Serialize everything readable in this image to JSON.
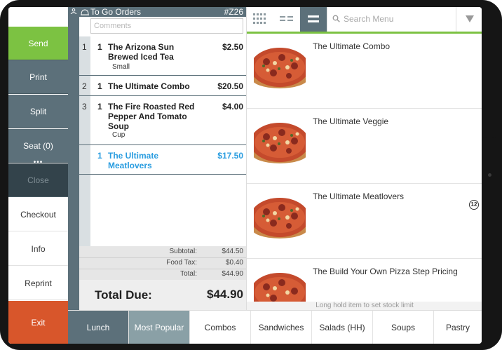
{
  "left_buttons": {
    "send": "Send",
    "print": "Print",
    "split": "Split",
    "seat": "Seat (0)",
    "seat_more": "•••",
    "close": "Close",
    "checkout": "Checkout",
    "info": "Info",
    "reprint": "Reprint",
    "exit": "Exit"
  },
  "order": {
    "title": "To Go Orders",
    "number": "#Z26",
    "comments_placeholder": "Comments",
    "lines": [
      {
        "seat": "1",
        "qty": "1",
        "name": "The Arizona Sun Brewed Iced Tea",
        "price": "$2.50",
        "modifier": "Small"
      },
      {
        "seat": "2",
        "qty": "1",
        "name": "The Ultimate Combo",
        "price": "$20.50",
        "modifier": ""
      },
      {
        "seat": "3",
        "qty": "1",
        "name": "The Fire Roasted Red Pepper And Tomato Soup",
        "price": "$4.00",
        "modifier": "Cup"
      },
      {
        "seat": "",
        "qty": "1",
        "name": "The Ultimate Meatlovers",
        "price": "$17.50",
        "modifier": ""
      }
    ],
    "subtotal_label": "Subtotal:",
    "subtotal": "$44.50",
    "tax_label": "Food Tax:",
    "tax": "$0.40",
    "total_label": "Total:",
    "total": "$44.90",
    "due_label": "Total Due:",
    "due": "$44.90"
  },
  "menu": {
    "search_placeholder": "Search Menu",
    "items": [
      {
        "name": "The Ultimate Combo"
      },
      {
        "name": "The Ultimate Veggie"
      },
      {
        "name": "The Ultimate Meatlovers"
      },
      {
        "name": "The Build Your Own Pizza Step Pricing"
      }
    ],
    "badge": "12",
    "hint": "Long hold item to set stock limit"
  },
  "tabs": [
    "Lunch",
    "Most Popular",
    "Combos",
    "Sandwiches",
    "Salads (HH)",
    "Soups",
    "Pastry"
  ],
  "colors": {
    "send": "#7cc242",
    "slate": "#5c707a",
    "exit": "#d8562b",
    "selected_line": "#2a9de0"
  }
}
